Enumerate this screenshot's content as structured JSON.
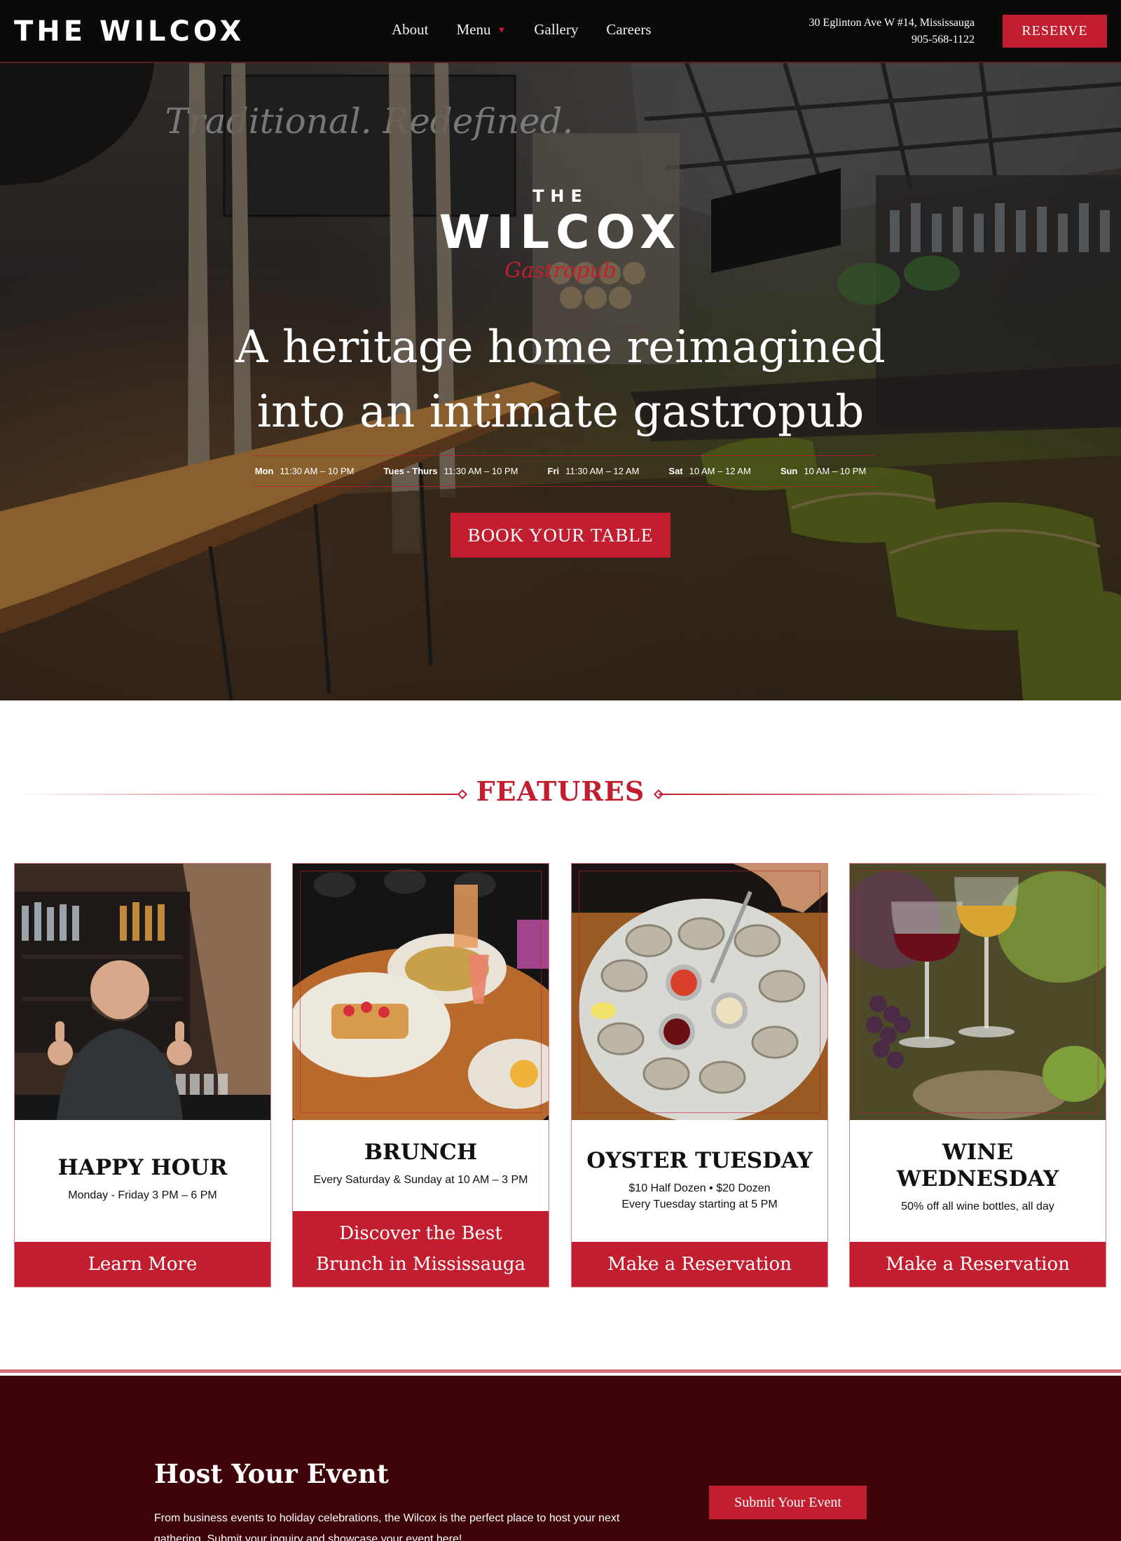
{
  "header": {
    "brand": "THE WILCOX",
    "nav": [
      {
        "label": "About"
      },
      {
        "label": "Menu",
        "has_dropdown": true
      },
      {
        "label": "Gallery"
      },
      {
        "label": "Careers"
      }
    ],
    "address": "30 Eglinton Ave W #14, Mississauga",
    "phone": "905-568-1122",
    "reserve_label": "RESERVE"
  },
  "hero": {
    "logo_the": "THE",
    "logo_name": "WILCOX",
    "logo_script": "Gastropub",
    "headline_line1": "A heritage home reimagined",
    "headline_line2": "into an intimate gastropub",
    "hours": [
      {
        "day": "Mon",
        "time": "11:30 AM – 10 PM"
      },
      {
        "day": "Tues - Thurs",
        "time": "11:30 AM – 10 PM"
      },
      {
        "day": "Fri",
        "time": "11:30 AM – 12 AM"
      },
      {
        "day": "Sat",
        "time": "10 AM – 12 AM"
      },
      {
        "day": "Sun",
        "time": "10 AM – 10 PM"
      }
    ],
    "cta_label": "BOOK YOUR TABLE",
    "chalkboard_text": "Traditional. Redefined."
  },
  "features": {
    "title": "FEATURES",
    "cards": [
      {
        "title": "HAPPY HOUR",
        "text_lines": [
          "Monday - Friday 3 PM – 6 PM"
        ],
        "button": "Learn More"
      },
      {
        "title": "BRUNCH",
        "text_lines": [
          "Every Saturday & Sunday at 10 AM – 3 PM"
        ],
        "button": "Discover the Best Brunch in Mississauga"
      },
      {
        "title": "OYSTER TUESDAY",
        "text_lines": [
          "$10 Half Dozen • $20 Dozen",
          "Every Tuesday starting at 5 PM"
        ],
        "button": "Make a Reservation"
      },
      {
        "title": "WINE WEDNESDAY",
        "text_lines": [
          "50% off all wine bottles, all day"
        ],
        "button": "Make a Reservation"
      }
    ]
  },
  "event": {
    "title": "Host Your Event",
    "text": "From business events to holiday celebrations, the Wilcox is the perfect place to host your next gathering. Submit your inquiry and showcase your event here!",
    "button": "Submit Your Event"
  },
  "colors": {
    "accent": "#c21e30",
    "header_bg": "#0c0909",
    "event_bg": "#3d0309"
  }
}
